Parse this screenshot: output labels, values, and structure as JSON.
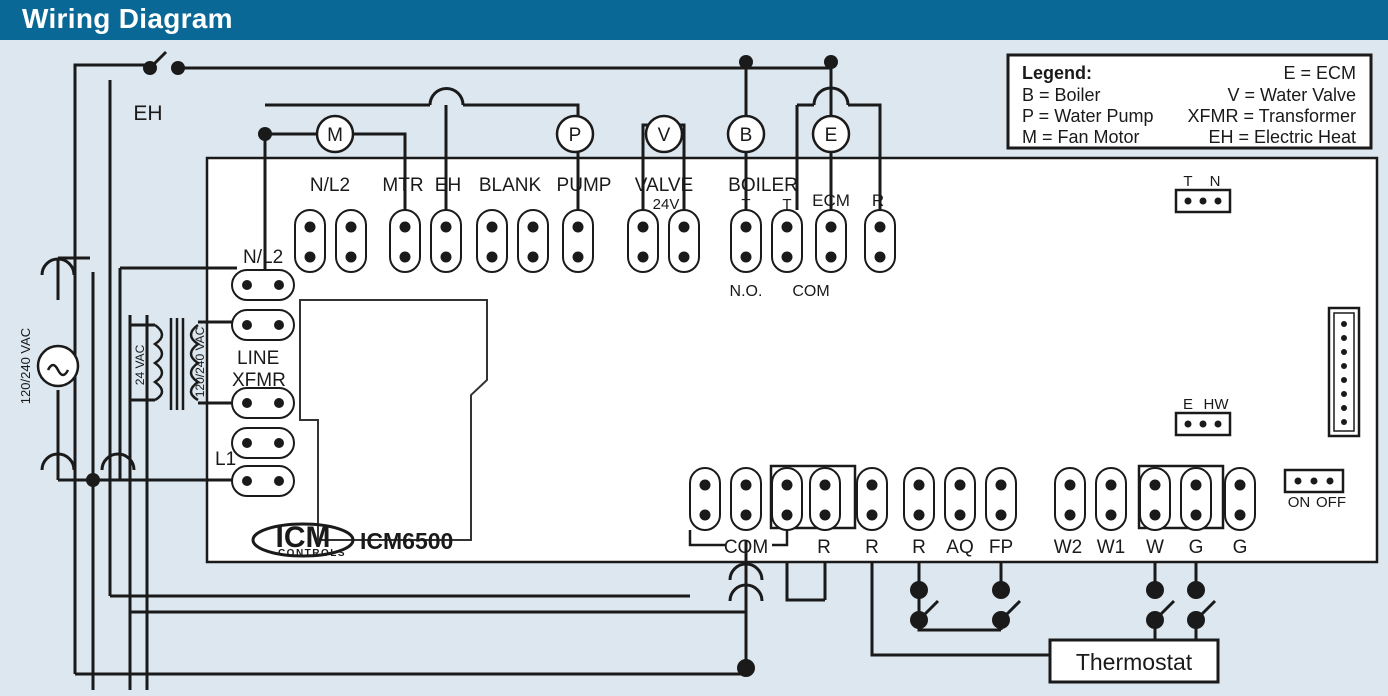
{
  "header": {
    "title": "Wiring Diagram"
  },
  "colors": {
    "header_bg": "#0a6896",
    "page_bg": "#dce7ef",
    "board_bg": "#ffffff",
    "wire": "#1a1a1a",
    "text": "#1a1a1a"
  },
  "legend": {
    "title": "Legend:",
    "left_entries": [
      "B = Boiler",
      "P = Water Pump",
      "M = Fan Motor"
    ],
    "right_entries": [
      "E = ECM",
      "V = Water Valve",
      "XFMR = Transformer",
      "EH = Electric Heat"
    ]
  },
  "board": {
    "brand": "ICM",
    "brand_sub": "CONTROLS",
    "model": "ICM6500"
  },
  "components": {
    "motor": "M",
    "pump": "P",
    "valve": "V",
    "boiler": "B",
    "ecm": "E",
    "electric_heat_switch": "EH",
    "ac_source_label": "120/240 VAC",
    "xfmr_primary_label": "120/240 VAC",
    "xfmr_secondary_label": "24 VAC",
    "thermostat": "Thermostat"
  },
  "top_terminals": [
    {
      "label": "N/L2",
      "sub": "",
      "span": 2
    },
    {
      "label": "MTR",
      "sub": "",
      "span": 1
    },
    {
      "label": "EH",
      "sub": "",
      "span": 1
    },
    {
      "label": "BLANK",
      "sub": "",
      "span": 2
    },
    {
      "label": "PUMP",
      "sub": "",
      "span": 1
    },
    {
      "label": "VALVE",
      "sub": "24V",
      "span": 2
    },
    {
      "label": "BOILER",
      "sub": "",
      "span": 2
    },
    {
      "label": "ECM",
      "sub": "",
      "span": 1
    },
    {
      "label": "R",
      "sub": "",
      "span": 1
    }
  ],
  "boiler_sublabels": {
    "no": "N.O.",
    "com": "COM"
  },
  "boiler_pin_labels": {
    "left": "T",
    "right": "T"
  },
  "left_terminals": [
    {
      "label": "N/L2"
    },
    {
      "label": ""
    },
    {
      "label": "LINE XFMR"
    },
    {
      "label": ""
    },
    {
      "label": "L1"
    }
  ],
  "left_terminal_labels": {
    "nl2": "N/L2",
    "line": "LINE",
    "xfmr": "XFMR",
    "l1": "L1"
  },
  "bottom_terminals": [
    {
      "label": "",
      "boxed": false
    },
    {
      "label": "COM",
      "boxed": false
    },
    {
      "label": "",
      "boxed": true
    },
    {
      "label": "R",
      "boxed": true
    },
    {
      "label": "R",
      "boxed": false
    },
    {
      "label": "R",
      "boxed": false
    },
    {
      "label": "AQ",
      "boxed": false
    },
    {
      "label": "FP",
      "boxed": false
    },
    {
      "label": "W2",
      "boxed": false
    },
    {
      "label": "W1",
      "boxed": false
    },
    {
      "label": "W",
      "boxed": true
    },
    {
      "label": "G",
      "boxed": true
    },
    {
      "label": "G",
      "boxed": false
    }
  ],
  "jumpers": {
    "tn": {
      "left": "T",
      "right": "N"
    },
    "ehw": {
      "left": "E",
      "right": "HW"
    },
    "onoff": {
      "left": "ON",
      "right": "OFF"
    }
  }
}
